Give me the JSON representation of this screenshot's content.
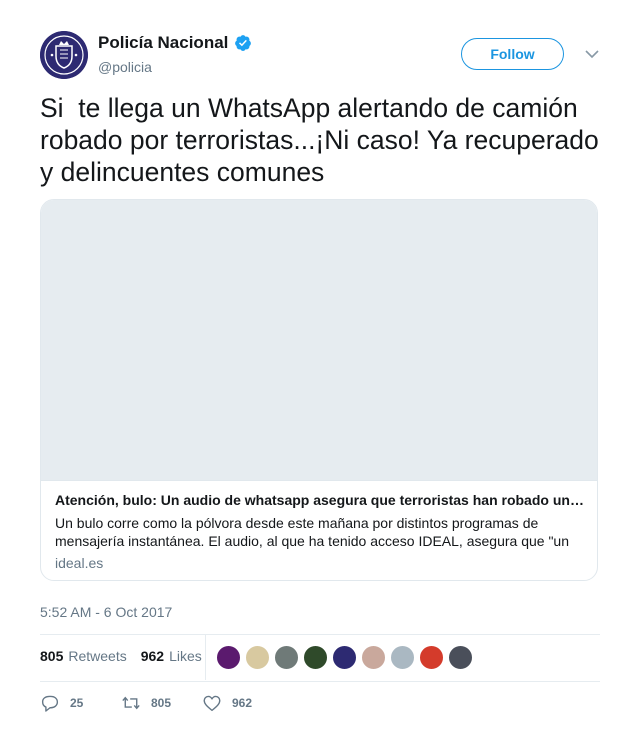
{
  "account": {
    "display_name": "Policía Nacional",
    "handle": "@policia",
    "verified": true,
    "avatar_icon": "policia-nacional-crest-icon",
    "verified_icon": "verified-badge-icon"
  },
  "header": {
    "follow_label": "Follow",
    "menu_icon": "chevron-down-icon"
  },
  "tweet": {
    "text": "Si  te llega un WhatsApp alertando de camión robado por terroristas...¡Ni caso! Ya recuperado y delincuentes comunes",
    "timestamp": "5:52 AM - 6 Oct 2017"
  },
  "card": {
    "title": "Atención, bulo: Un audio de whatsapp asegura que terroristas han robado un camión",
    "description": "Un bulo corre como la pólvora desde este mañana por distintos programas de mensajería instantánea. El audio, al que ha tenido acceso IDEAL, asegura que \"un",
    "domain": "ideal.es"
  },
  "stats": {
    "retweets_count": "805",
    "retweets_label": "Retweets",
    "likes_count": "962",
    "likes_label": "Likes"
  },
  "likers": [
    {
      "color": "#5b1a6e"
    },
    {
      "color": "#d8c9a0"
    },
    {
      "color": "#6f7a78"
    },
    {
      "color": "#2f4a2a"
    },
    {
      "color": "#2d2a72"
    },
    {
      "color": "#c9a89c"
    },
    {
      "color": "#aab8c2"
    },
    {
      "color": "#d43b2b"
    },
    {
      "color": "#4a4f5a"
    }
  ],
  "actions": {
    "reply_count": "25",
    "retweet_count": "805",
    "like_count": "962"
  },
  "colors": {
    "accent": "#1b95e0",
    "text": "#14171a",
    "secondary": "#657786",
    "border": "#e1e8ed"
  }
}
